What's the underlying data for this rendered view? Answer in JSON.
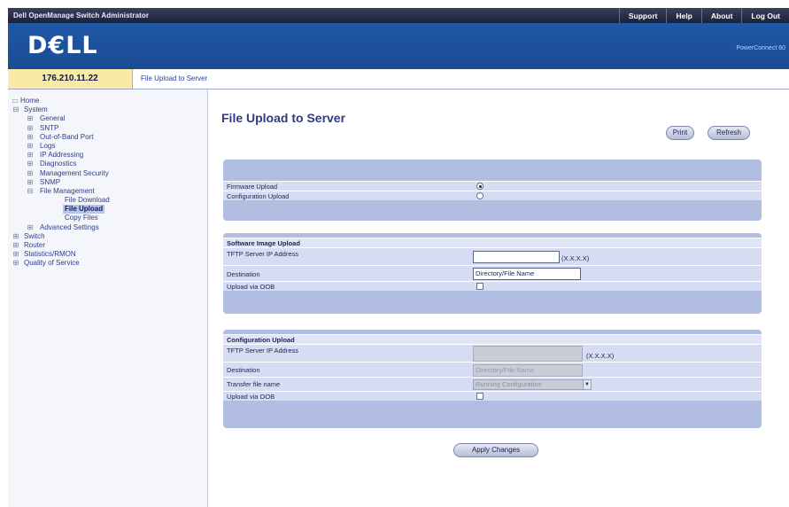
{
  "header": {
    "app_title": "Dell OpenManage Switch Administrator",
    "nav": [
      "Support",
      "Help",
      "About",
      "Log Out"
    ],
    "logo": "D€LL",
    "tagline": "PowerConnect 60"
  },
  "ipbar": {
    "ip": "176.210.11.22",
    "breadcrumb": "File Upload to Server"
  },
  "tree": {
    "items": [
      {
        "label": "Home",
        "exp": ""
      },
      {
        "label": "System",
        "exp": "⊟"
      },
      {
        "label": "General",
        "exp": "⊞"
      },
      {
        "label": "SNTP",
        "exp": "⊞"
      },
      {
        "label": "Out-of-Band Port",
        "exp": "⊞"
      },
      {
        "label": "Logs",
        "exp": "⊞"
      },
      {
        "label": "IP Addressing",
        "exp": "⊞"
      },
      {
        "label": "Diagnostics",
        "exp": "⊞"
      },
      {
        "label": "Management Security",
        "exp": "⊞"
      },
      {
        "label": "SNMP",
        "exp": "⊞"
      },
      {
        "label": "File Management",
        "exp": "⊟"
      },
      {
        "label": "File Download",
        "exp": ""
      },
      {
        "label": "File Upload",
        "exp": ""
      },
      {
        "label": "Copy Files",
        "exp": ""
      },
      {
        "label": "Advanced Settings",
        "exp": "⊞"
      },
      {
        "label": "Switch",
        "exp": "⊞"
      },
      {
        "label": "Router",
        "exp": "⊞"
      },
      {
        "label": "Statistics/RMON",
        "exp": "⊞"
      },
      {
        "label": "Quality of Service",
        "exp": "⊞"
      }
    ]
  },
  "page": {
    "title": "File Upload to Server",
    "print_label": "Print",
    "refresh_label": "Refresh",
    "apply_label": "Apply Changes"
  },
  "upload_type": {
    "firmware_label": "Firmware Upload",
    "firmware_selected": true,
    "config_label": "Configuration Upload",
    "config_selected": false
  },
  "software_image": {
    "header": "Software Image Upload",
    "tftp_label": "TFTP Server IP Address",
    "tftp_value": "",
    "tftp_hint": "(X.X.X.X)",
    "destination_label": "Destination",
    "destination_value": "Directory/File Name",
    "oob_label": "Upload via OOB",
    "oob_checked": false
  },
  "configuration": {
    "header": "Configuration Upload",
    "tftp_label": "TFTP Server IP Address",
    "tftp_value": "",
    "tftp_hint": "(X.X.X.X)",
    "destination_label": "Destination",
    "destination_value": "Directory/File Name",
    "transfer_label": "Transfer file name",
    "transfer_value": "Running Configuration",
    "oob_label": "Upload via OOB",
    "oob_checked": false
  }
}
